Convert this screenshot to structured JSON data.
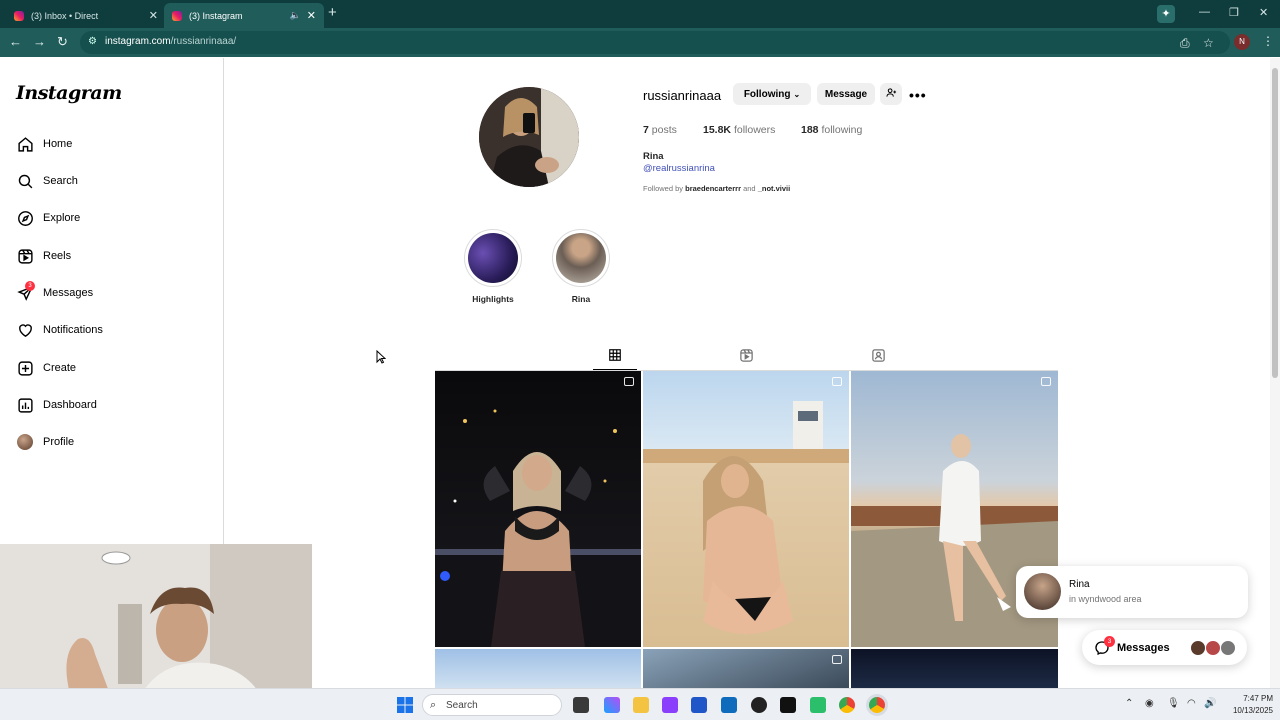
{
  "browser": {
    "tabs": [
      {
        "title": "(3) Inbox • Direct",
        "active": false
      },
      {
        "title": "(3) Instagram",
        "active": true
      }
    ],
    "url_host": "instagram.com",
    "url_path": "/russianrinaaa/",
    "profile_initial": "N"
  },
  "sidebar": {
    "logo": "Instagram",
    "items": [
      {
        "label": "Home",
        "icon": "home-icon"
      },
      {
        "label": "Search",
        "icon": "search-icon"
      },
      {
        "label": "Explore",
        "icon": "compass-icon"
      },
      {
        "label": "Reels",
        "icon": "reels-icon"
      },
      {
        "label": "Messages",
        "icon": "messenger-icon",
        "badge": "3"
      },
      {
        "label": "Notifications",
        "icon": "heart-icon"
      },
      {
        "label": "Create",
        "icon": "plus-square-icon"
      },
      {
        "label": "Dashboard",
        "icon": "chart-icon"
      },
      {
        "label": "Profile",
        "icon": "avatar"
      }
    ]
  },
  "profile": {
    "username": "russianrinaaa",
    "following_btn": "Following",
    "message_btn": "Message",
    "posts_count": "7",
    "posts_label": "posts",
    "followers_count": "15.8K",
    "followers_label": "followers",
    "following_count": "188",
    "following_label": "following",
    "full_name": "Rina",
    "handle_link": "@realrussianrina",
    "followed_prefix": "Followed by",
    "followed_user1": "braedencarterrr",
    "followed_and": "and",
    "followed_user2": "_not.vivii"
  },
  "highlights": [
    {
      "label": "Highlights"
    },
    {
      "label": "Rina"
    }
  ],
  "notification": {
    "name": "Rina",
    "text": "in wyndwood area"
  },
  "messages_pill": {
    "label": "Messages",
    "badge": "3"
  },
  "taskbar": {
    "search_placeholder": "Search",
    "time": "7:47 PM",
    "date": "10/13/2025"
  },
  "colors": {
    "browser_dark": "#0f3d3e",
    "browser_toolbar": "#1f5c5a",
    "badge_red": "#ff3040",
    "link_blue": "#4150b8"
  }
}
